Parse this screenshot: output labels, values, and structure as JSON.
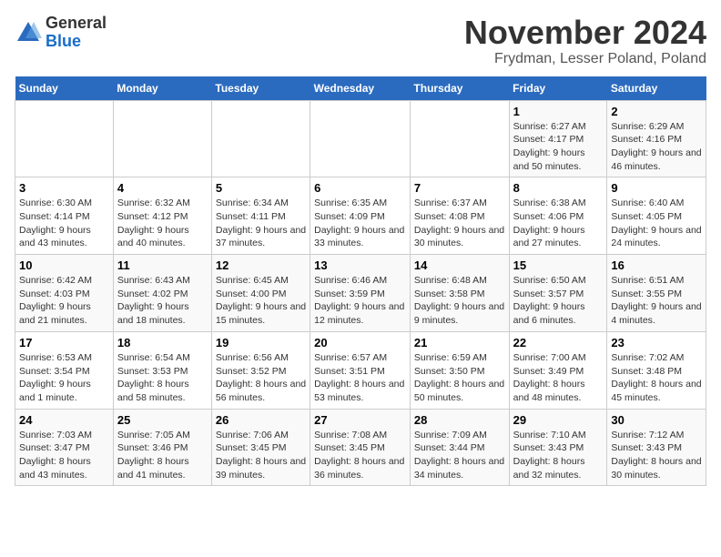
{
  "header": {
    "logo_line1": "General",
    "logo_line2": "Blue",
    "title": "November 2024",
    "subtitle": "Frydman, Lesser Poland, Poland"
  },
  "days_of_week": [
    "Sunday",
    "Monday",
    "Tuesday",
    "Wednesday",
    "Thursday",
    "Friday",
    "Saturday"
  ],
  "weeks": [
    [
      {
        "day": "",
        "info": ""
      },
      {
        "day": "",
        "info": ""
      },
      {
        "day": "",
        "info": ""
      },
      {
        "day": "",
        "info": ""
      },
      {
        "day": "",
        "info": ""
      },
      {
        "day": "1",
        "info": "Sunrise: 6:27 AM\nSunset: 4:17 PM\nDaylight: 9 hours and 50 minutes."
      },
      {
        "day": "2",
        "info": "Sunrise: 6:29 AM\nSunset: 4:16 PM\nDaylight: 9 hours and 46 minutes."
      }
    ],
    [
      {
        "day": "3",
        "info": "Sunrise: 6:30 AM\nSunset: 4:14 PM\nDaylight: 9 hours and 43 minutes."
      },
      {
        "day": "4",
        "info": "Sunrise: 6:32 AM\nSunset: 4:12 PM\nDaylight: 9 hours and 40 minutes."
      },
      {
        "day": "5",
        "info": "Sunrise: 6:34 AM\nSunset: 4:11 PM\nDaylight: 9 hours and 37 minutes."
      },
      {
        "day": "6",
        "info": "Sunrise: 6:35 AM\nSunset: 4:09 PM\nDaylight: 9 hours and 33 minutes."
      },
      {
        "day": "7",
        "info": "Sunrise: 6:37 AM\nSunset: 4:08 PM\nDaylight: 9 hours and 30 minutes."
      },
      {
        "day": "8",
        "info": "Sunrise: 6:38 AM\nSunset: 4:06 PM\nDaylight: 9 hours and 27 minutes."
      },
      {
        "day": "9",
        "info": "Sunrise: 6:40 AM\nSunset: 4:05 PM\nDaylight: 9 hours and 24 minutes."
      }
    ],
    [
      {
        "day": "10",
        "info": "Sunrise: 6:42 AM\nSunset: 4:03 PM\nDaylight: 9 hours and 21 minutes."
      },
      {
        "day": "11",
        "info": "Sunrise: 6:43 AM\nSunset: 4:02 PM\nDaylight: 9 hours and 18 minutes."
      },
      {
        "day": "12",
        "info": "Sunrise: 6:45 AM\nSunset: 4:00 PM\nDaylight: 9 hours and 15 minutes."
      },
      {
        "day": "13",
        "info": "Sunrise: 6:46 AM\nSunset: 3:59 PM\nDaylight: 9 hours and 12 minutes."
      },
      {
        "day": "14",
        "info": "Sunrise: 6:48 AM\nSunset: 3:58 PM\nDaylight: 9 hours and 9 minutes."
      },
      {
        "day": "15",
        "info": "Sunrise: 6:50 AM\nSunset: 3:57 PM\nDaylight: 9 hours and 6 minutes."
      },
      {
        "day": "16",
        "info": "Sunrise: 6:51 AM\nSunset: 3:55 PM\nDaylight: 9 hours and 4 minutes."
      }
    ],
    [
      {
        "day": "17",
        "info": "Sunrise: 6:53 AM\nSunset: 3:54 PM\nDaylight: 9 hours and 1 minute."
      },
      {
        "day": "18",
        "info": "Sunrise: 6:54 AM\nSunset: 3:53 PM\nDaylight: 8 hours and 58 minutes."
      },
      {
        "day": "19",
        "info": "Sunrise: 6:56 AM\nSunset: 3:52 PM\nDaylight: 8 hours and 56 minutes."
      },
      {
        "day": "20",
        "info": "Sunrise: 6:57 AM\nSunset: 3:51 PM\nDaylight: 8 hours and 53 minutes."
      },
      {
        "day": "21",
        "info": "Sunrise: 6:59 AM\nSunset: 3:50 PM\nDaylight: 8 hours and 50 minutes."
      },
      {
        "day": "22",
        "info": "Sunrise: 7:00 AM\nSunset: 3:49 PM\nDaylight: 8 hours and 48 minutes."
      },
      {
        "day": "23",
        "info": "Sunrise: 7:02 AM\nSunset: 3:48 PM\nDaylight: 8 hours and 45 minutes."
      }
    ],
    [
      {
        "day": "24",
        "info": "Sunrise: 7:03 AM\nSunset: 3:47 PM\nDaylight: 8 hours and 43 minutes."
      },
      {
        "day": "25",
        "info": "Sunrise: 7:05 AM\nSunset: 3:46 PM\nDaylight: 8 hours and 41 minutes."
      },
      {
        "day": "26",
        "info": "Sunrise: 7:06 AM\nSunset: 3:45 PM\nDaylight: 8 hours and 39 minutes."
      },
      {
        "day": "27",
        "info": "Sunrise: 7:08 AM\nSunset: 3:45 PM\nDaylight: 8 hours and 36 minutes."
      },
      {
        "day": "28",
        "info": "Sunrise: 7:09 AM\nSunset: 3:44 PM\nDaylight: 8 hours and 34 minutes."
      },
      {
        "day": "29",
        "info": "Sunrise: 7:10 AM\nSunset: 3:43 PM\nDaylight: 8 hours and 32 minutes."
      },
      {
        "day": "30",
        "info": "Sunrise: 7:12 AM\nSunset: 3:43 PM\nDaylight: 8 hours and 30 minutes."
      }
    ]
  ]
}
